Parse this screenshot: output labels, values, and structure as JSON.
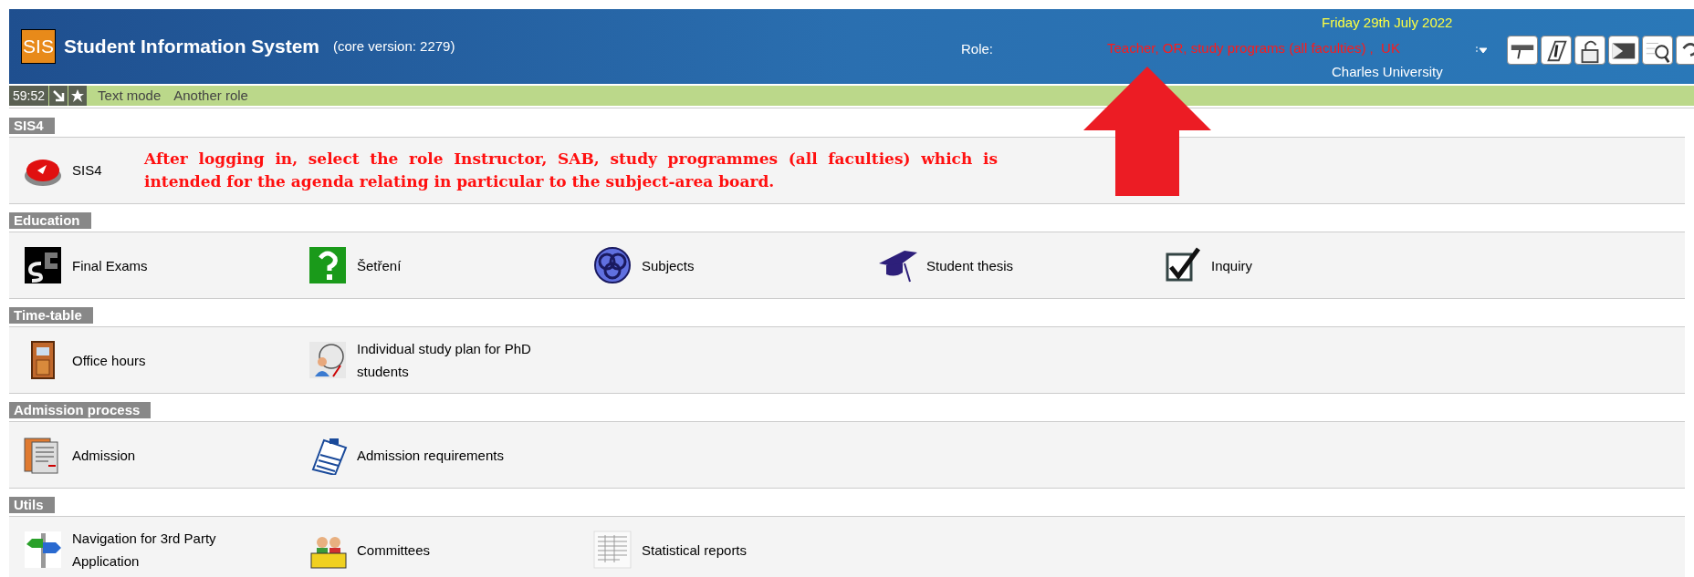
{
  "header": {
    "logo": "SIS",
    "title": "Student Information System",
    "version": "(core version: 2279)",
    "role_label": "Role:",
    "role": "Teacher, OR, study programs (all faculties) ,  UK",
    "date": "Friday 29th July 2022",
    "university": "Charles University"
  },
  "status_bar": {
    "timer": "59:52",
    "links": [
      "Text mode",
      "Another role"
    ]
  },
  "sections": [
    {
      "title": "SIS4",
      "items": [
        {
          "label": "SIS4"
        }
      ],
      "note": "After logging in, select the role Instructor, SAB, study programmes (all faculties) which is intended for the agenda relating in particular to the subject-area board."
    },
    {
      "title": "Education",
      "items": [
        {
          "label": "Final Exams"
        },
        {
          "label": "Šetření"
        },
        {
          "label": "Subjects"
        },
        {
          "label": "Student thesis"
        },
        {
          "label": "Inquiry"
        }
      ]
    },
    {
      "title": "Time-table",
      "items": [
        {
          "label": "Office hours"
        },
        {
          "label": "Individual study plan for PhD students"
        }
      ]
    },
    {
      "title": "Admission process",
      "items": [
        {
          "label": "Admission"
        },
        {
          "label": "Admission requirements"
        }
      ]
    },
    {
      "title": "Utils",
      "items": [
        {
          "label": "Navigation for 3rd Party Application"
        },
        {
          "label": "Committees"
        },
        {
          "label": "Statistical reports"
        }
      ]
    }
  ]
}
